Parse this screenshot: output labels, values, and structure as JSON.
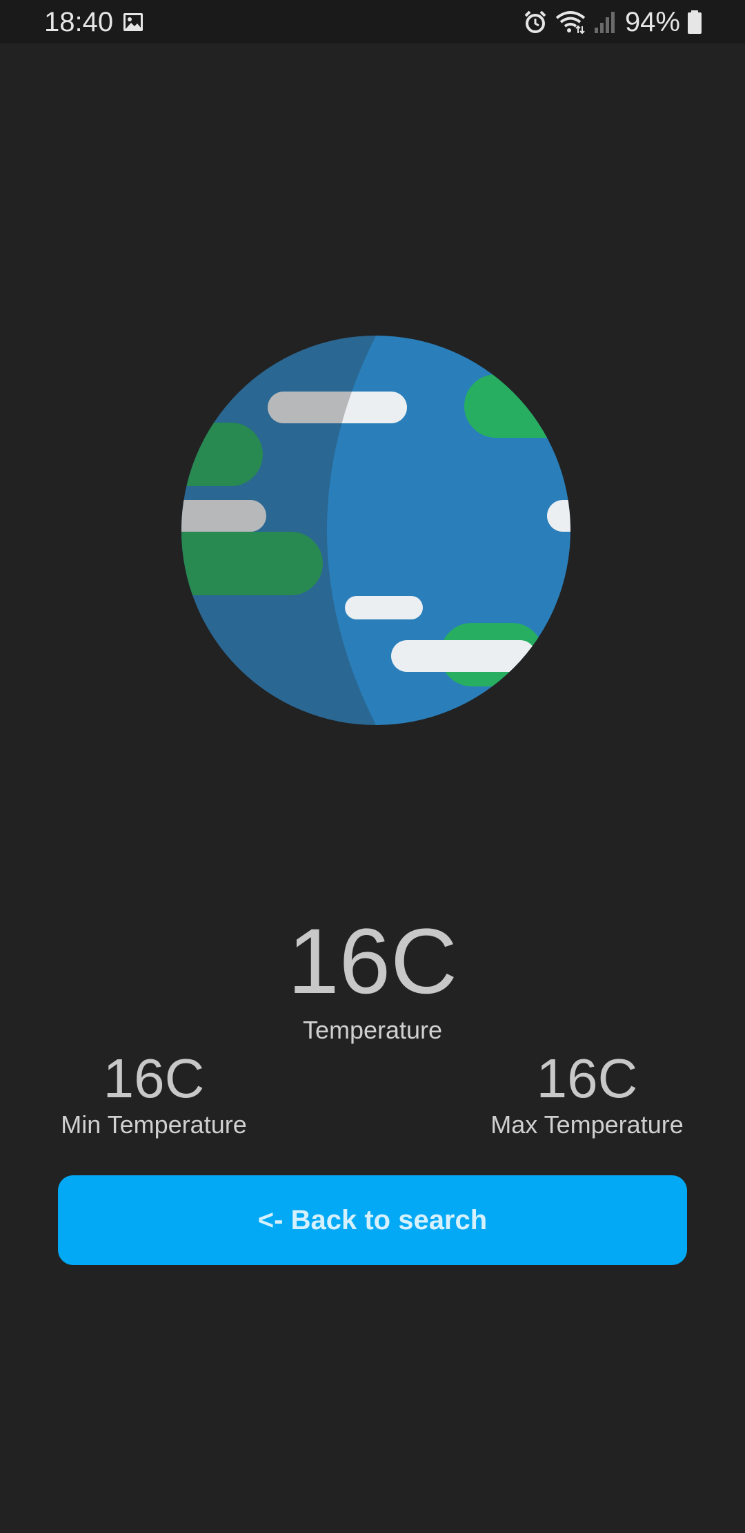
{
  "status_bar": {
    "time": "18:40",
    "battery": "94%",
    "icons": [
      "image-icon",
      "alarm-icon",
      "wifi-icon",
      "signal-icon",
      "battery-icon"
    ]
  },
  "globe": {
    "icon": "earth-globe-icon",
    "colors": {
      "ocean": "#2a7fba",
      "ocean_shade": "#4a7a9c",
      "land": "#27ae60",
      "cloud": "#eceff1"
    }
  },
  "weather": {
    "temperature": "16C",
    "temperature_label": "Temperature",
    "min_temperature": "16C",
    "min_label": "Min Temperature",
    "max_temperature": "16C",
    "max_label": "Max Temperature"
  },
  "actions": {
    "back_label": "<- Back to search"
  },
  "colors": {
    "background": "#222222",
    "button": "#03a9f4",
    "button_text": "#d6f1fd"
  }
}
